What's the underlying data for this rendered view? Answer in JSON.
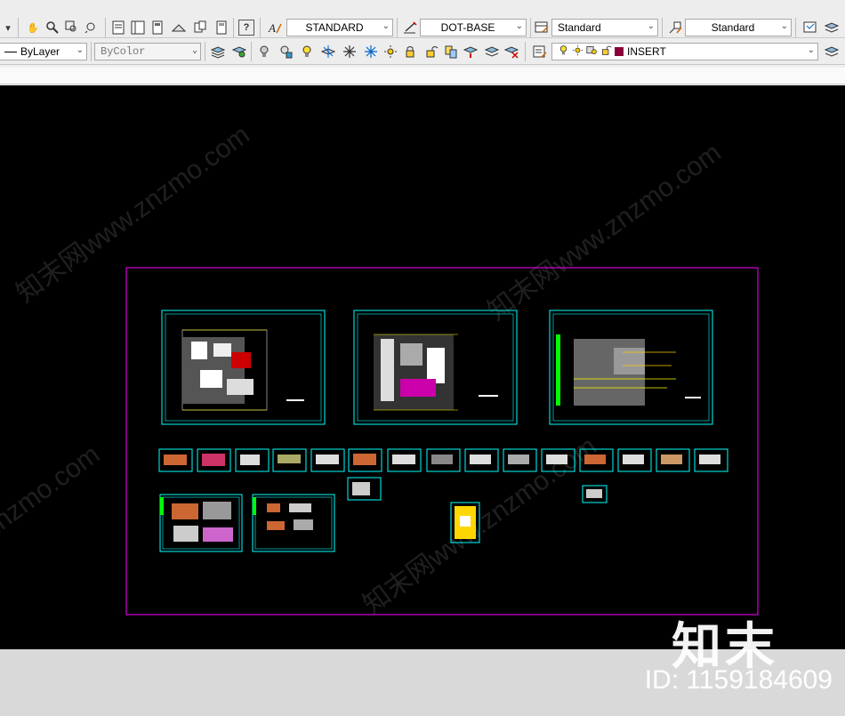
{
  "toolbar1": {
    "text_style": "STANDARD",
    "dim_style": "DOT-BASE",
    "table_style": "Standard",
    "multileader_style": "Standard"
  },
  "toolbar2": {
    "linetype": "ByLayer",
    "color": "ByColor",
    "layer_name": "INSERT"
  },
  "colors": {
    "canvas": "#000000",
    "sheet_frame": "#00ffff",
    "layout_border": "#ff00ff",
    "layer_swatch": "#8b0038"
  },
  "watermarks": [
    "知末网www.znzmo.com",
    "znzmo.com"
  ],
  "brand": {
    "logo": "知末",
    "id_text": "ID: 1159184609"
  }
}
